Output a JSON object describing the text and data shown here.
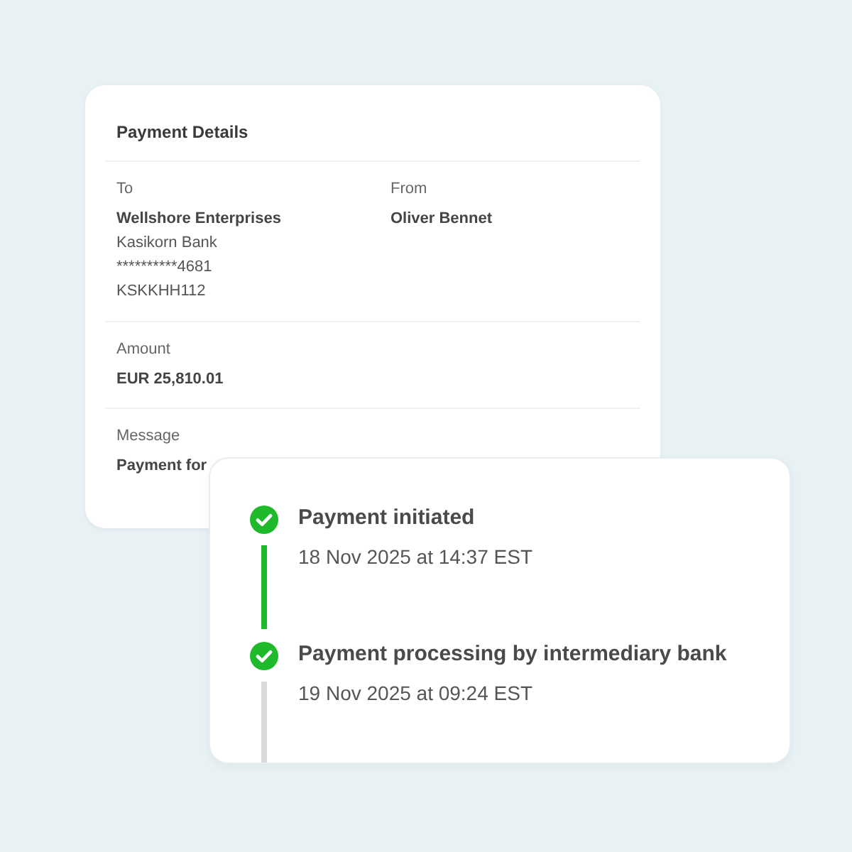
{
  "details": {
    "title": "Payment Details",
    "parties": [
      {
        "label": "To",
        "name": "Wellshore Enterprises",
        "lines": [
          "Kasikorn Bank",
          "**********4681",
          "KSKKHH112"
        ]
      },
      {
        "label": "From",
        "name": "Oliver Bennet"
      }
    ],
    "amount": {
      "label": "Amount",
      "value": "EUR 25,810.01"
    },
    "message": {
      "label": "Message",
      "value": "Payment for"
    }
  },
  "timeline": {
    "steps": [
      {
        "title": "Payment initiated",
        "time": "18 Nov 2025 at 14:37 EST",
        "completed": true,
        "line_completed": true
      },
      {
        "title": "Payment processing by intermediary bank",
        "time": "19 Nov 2025 at 09:24 EST",
        "completed": true,
        "line_completed": false
      }
    ]
  }
}
